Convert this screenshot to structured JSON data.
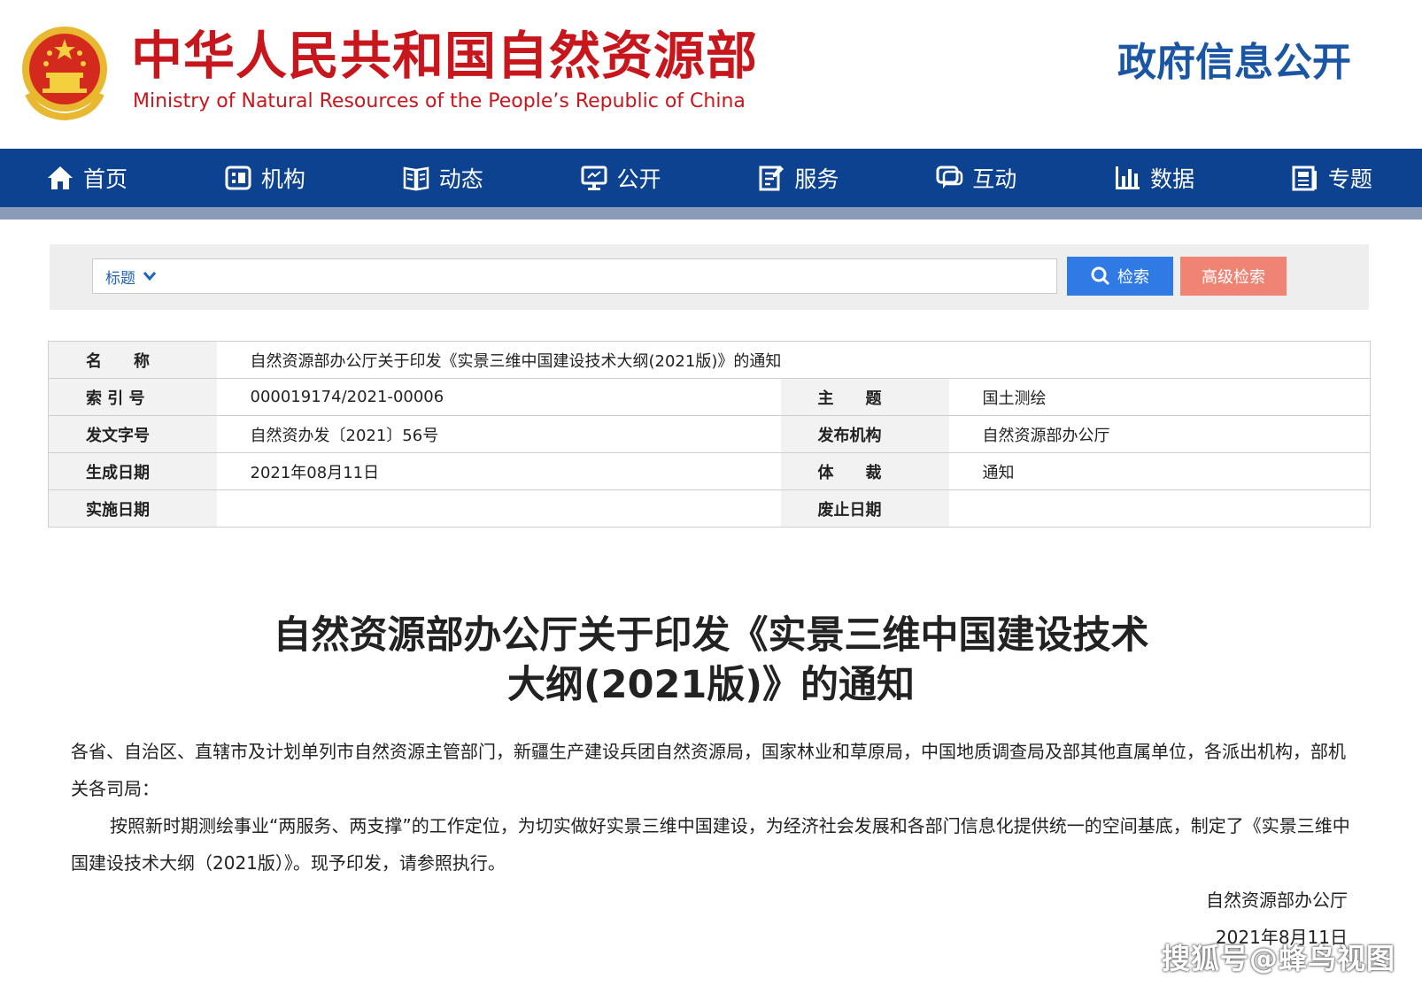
{
  "header": {
    "title_cn": "中华人民共和国自然资源部",
    "title_en": "Ministry of Natural Resources of the People’s Republic of China",
    "gov_open": "政府信息公开",
    "brand_color": "#c8161d",
    "accent_color": "#1a56a4"
  },
  "nav": {
    "items": [
      {
        "label": "首页",
        "icon": "home-icon"
      },
      {
        "label": "机构",
        "icon": "org-icon"
      },
      {
        "label": "动态",
        "icon": "news-icon"
      },
      {
        "label": "公开",
        "icon": "monitor-icon"
      },
      {
        "label": "服务",
        "icon": "service-icon"
      },
      {
        "label": "互动",
        "icon": "chat-icon"
      },
      {
        "label": "数据",
        "icon": "chart-icon"
      },
      {
        "label": "专题",
        "icon": "topic-icon"
      }
    ],
    "bg_color": "#0d4290"
  },
  "search": {
    "scope": "标题",
    "placeholder": "",
    "search_label": "检索",
    "advanced_label": "高级检索"
  },
  "info": {
    "name_label": "名　　称",
    "name_value": "自然资源部办公厅关于印发《实景三维中国建设技术大纲(2021版)》的通知",
    "index_label": "索 引 号",
    "index_value": "000019174/2021-00006",
    "topic_label": "主　　题",
    "topic_value": "国土测绘",
    "doc_no_label": "发文字号",
    "doc_no_value": "自然资办发〔2021〕56号",
    "publisher_label": "发布机构",
    "publisher_value": "自然资源部办公厅",
    "created_label": "生成日期",
    "created_value": "2021年08月11日",
    "genre_label": "体　　裁",
    "genre_value": "通知",
    "effective_label": "实施日期",
    "effective_value": "",
    "abolish_label": "废止日期",
    "abolish_value": ""
  },
  "document": {
    "title_line1": "自然资源部办公厅关于印发《实景三维中国建设技术",
    "title_line2": "大纲(2021版)》的通知",
    "para1": "各省、自治区、直辖市及计划单列市自然资源主管部门，新疆生产建设兵团自然资源局，国家林业和草原局，中国地质调查局及部其他直属单位，各派出机构，部机关各司局：",
    "para2": "按照新时期测绘事业“两服务、两支撑”的工作定位，为切实做好实景三维中国建设，为经济社会发展和各部门信息化提供统一的空间基底，制定了《实景三维中国建设技术大纲（2021版）》。现予印发，请参照执行。",
    "signer": "自然资源部办公厅",
    "date": "2021年8月11日"
  },
  "watermark": "搜狐号@蜂鸟视图"
}
